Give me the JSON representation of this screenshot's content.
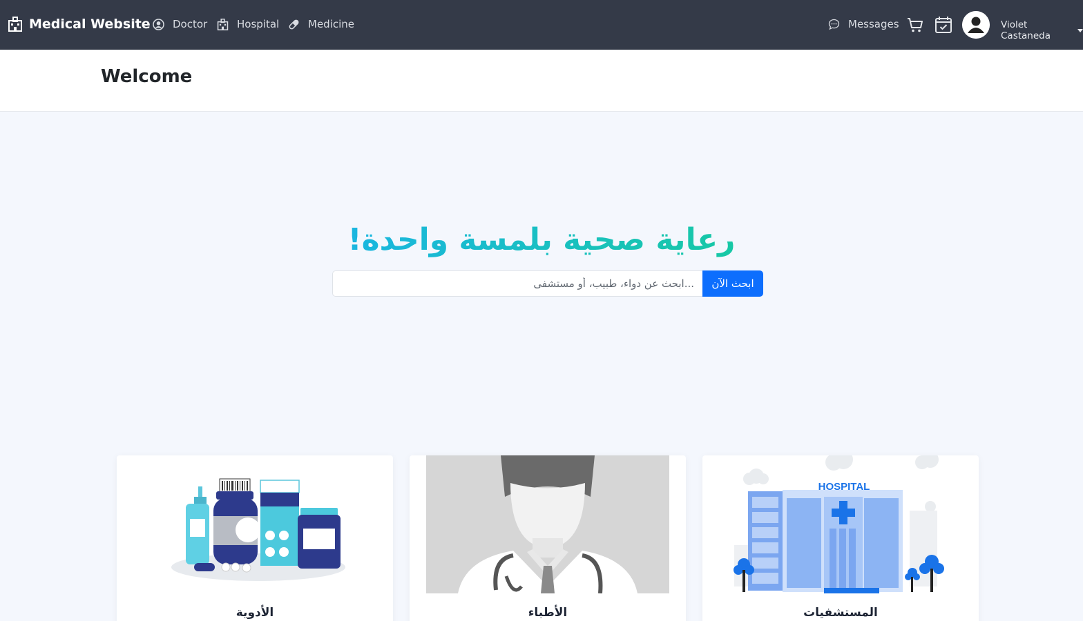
{
  "navbar": {
    "brand": "Medical Website",
    "links": {
      "doctor": "Doctor",
      "hospital": "Hospital",
      "medicine": "Medicine",
      "messages": "Messages"
    },
    "user_name": "Violet Castaneda"
  },
  "header": {
    "title": "Welcome"
  },
  "hero": {
    "title": "رعاية صحية بلمسة واحدة!",
    "search_placeholder": "...ابحث عن دواء، طبيب، أو مستشفى",
    "search_button": "ابحث الآن"
  },
  "cards": [
    {
      "label": "الأدوية",
      "icon": "medicine-bottles-illustration"
    },
    {
      "label": "الأطباء",
      "icon": "doctor-illustration"
    },
    {
      "label": "المستشفيات",
      "icon": "hospital-building-illustration"
    }
  ],
  "colors": {
    "navbar_bg": "#343a48",
    "page_bg": "#f4f7fd",
    "accent_blue": "#0d6efd",
    "hero_gradient_start": "#1ab6e0",
    "hero_gradient_end": "#17c8a5"
  }
}
